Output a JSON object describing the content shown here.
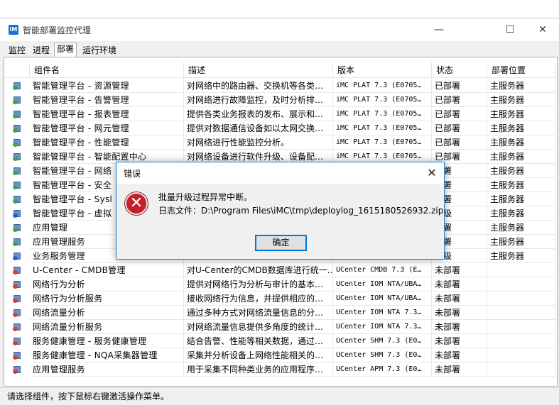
{
  "window": {
    "title": "智能部署监控代理",
    "minimize_glyph": "—",
    "maximize_glyph": "☐",
    "close_glyph": "✕"
  },
  "tabs": [
    {
      "label": "监控"
    },
    {
      "label": "进程"
    },
    {
      "label": "部署",
      "active": true
    },
    {
      "label": "运行环境"
    }
  ],
  "table": {
    "columns": [
      "组件名",
      "描述",
      "版本",
      "状态",
      "部署位置"
    ],
    "rows": [
      {
        "name": "智能管理平台 - 资源管理",
        "desc": "对网络中的路由器、交换机等各类…",
        "version": "iMC PLAT 7.3 (E0705…",
        "status": "已部署",
        "location": "主服务器",
        "icon_color": "#3aa83a"
      },
      {
        "name": "智能管理平台 - 告警管理",
        "desc": "对网络进行故障监控，及时分析排…",
        "version": "iMC PLAT 7.3 (E0705…",
        "status": "已部署",
        "location": "主服务器",
        "icon_color": "#3aa83a"
      },
      {
        "name": "智能管理平台 - 报表管理",
        "desc": "提供各类业务报表的发布、展示和…",
        "version": "iMC PLAT 7.3 (E0705…",
        "status": "已部署",
        "location": "主服务器",
        "icon_color": "#3aa83a"
      },
      {
        "name": "智能管理平台 - 网元管理",
        "desc": "提供对数据通信设备如以太网交换…",
        "version": "iMC PLAT 7.3 (E0705…",
        "status": "已部署",
        "location": "主服务器",
        "icon_color": "#3aa83a"
      },
      {
        "name": "智能管理平台 - 性能管理",
        "desc": "对网络进行性能监控分析。",
        "version": "iMC PLAT 7.3 (E0705…",
        "status": "已部署",
        "location": "主服务器",
        "icon_color": "#3aa83a"
      },
      {
        "name": "智能管理平台 - 智能配置中心",
        "desc": "对网络设备进行软件升级、设备配…",
        "version": "iMC PLAT 7.3 (E0705…",
        "status": "已部署",
        "location": "主服务器",
        "icon_color": "#3aa83a"
      },
      {
        "name": "智能管理平台 - 网络",
        "desc": "",
        "version": "",
        "status": "部署",
        "location": "主服务器",
        "icon_color": "#3aa83a"
      },
      {
        "name": "智能管理平台 - 安全",
        "desc": "",
        "version": "",
        "status": "部署",
        "location": "主服务器",
        "icon_color": "#3aa83a"
      },
      {
        "name": "智能管理平台 - Sysl",
        "desc": "",
        "version": "",
        "status": "部署",
        "location": "主服务器",
        "icon_color": "#3aa83a"
      },
      {
        "name": "智能管理平台 - 虚拟",
        "desc": "",
        "version": "",
        "status": "升级",
        "location": "主服务器",
        "icon_color": "#2b5fcc"
      },
      {
        "name": "应用管理",
        "desc": "",
        "version": "",
        "status": "部署",
        "location": "主服务器",
        "icon_color": "#3aa83a"
      },
      {
        "name": "应用管理服务",
        "desc": "",
        "version": "",
        "status": "部署",
        "location": "主服务器",
        "icon_color": "#3aa83a"
      },
      {
        "name": "业务服务管理",
        "desc": "",
        "version": "",
        "status": "升级",
        "location": "主服务器",
        "icon_color": "#2b5fcc"
      },
      {
        "name": "U-Center - CMDB管理",
        "desc": "对U-Center的CMDB数据库进行统一…",
        "version": "UCenter CMDB 7.3 (E…",
        "status": "未部署",
        "location": "",
        "icon_color": "#d9401f"
      },
      {
        "name": "网络行为分析",
        "desc": "提供对网络行为分析与审计的基本…",
        "version": "UCenter IOM NTA/UBA…",
        "status": "未部署",
        "location": "",
        "icon_color": "#d9401f"
      },
      {
        "name": "网络行为分析服务",
        "desc": "接收网络行为信息，并提供相应的…",
        "version": "UCenter IOM NTA/UBA…",
        "status": "未部署",
        "location": "",
        "icon_color": "#d9401f"
      },
      {
        "name": "网络流量分析",
        "desc": "通过多种方式对网络流量信息的分…",
        "version": "UCenter IOM NTA 7.3…",
        "status": "未部署",
        "location": "",
        "icon_color": "#d9401f"
      },
      {
        "name": "网络流量分析服务",
        "desc": "对网络流量信息提供多角度的统计…",
        "version": "UCenter IOM NTA 7.3…",
        "status": "未部署",
        "location": "",
        "icon_color": "#d9401f"
      },
      {
        "name": "服务健康管理 - 服务健康管理",
        "desc": "结合告警、性能等相关数据，通过…",
        "version": "UCenter SHM 7.3 (E0…",
        "status": "未部署",
        "location": "",
        "icon_color": "#d9401f"
      },
      {
        "name": "服务健康管理 - NQA采集器管理",
        "desc": "采集并分析设备上网络性能相关的…",
        "version": "UCenter SHM 7.3 (E0…",
        "status": "未部署",
        "location": "",
        "icon_color": "#d9401f"
      },
      {
        "name": "应用管理服务",
        "desc": "用于采集不同种类业务的应用程序…",
        "version": "UCenter APM 7.3 (E0…",
        "status": "未部署",
        "location": "",
        "icon_color": "#d9401f"
      }
    ]
  },
  "statusbar": {
    "text": "请选择组件，按下鼠标右键激活操作菜单。"
  },
  "dialog": {
    "title": "错误",
    "close_glyph": "✕",
    "icon_glyph": "✕",
    "message_line1": "批量升级过程异常中断。",
    "message_line2": "日志文件：D:\\Program Files\\iMC\\tmp\\deploylog_1615180526932.zip",
    "ok_label": "确定"
  }
}
